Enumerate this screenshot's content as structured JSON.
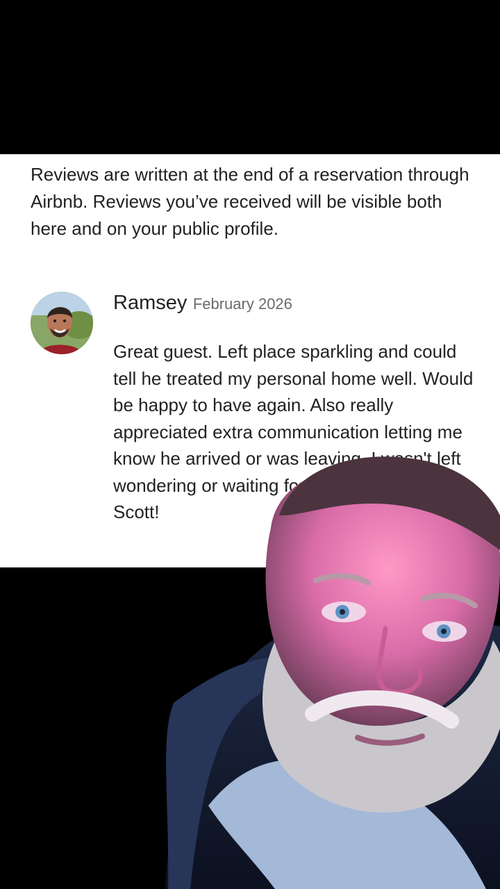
{
  "reviews_page": {
    "intro_text": "Reviews are written at the end of a reservation through Airbnb. Reviews you’ve received will be visible both here and on your public profile."
  },
  "review": {
    "reviewer_name": "Ramsey",
    "date": "February 2026",
    "body": "Great guest. Left place sparkling and could tell he treated my personal home well. Would be happy to have again. Also really appreciated extra communication letting me know he arrived or was leaving. I wasn't left wondering or waiting for anything. Thanks Scott!"
  },
  "colors": {
    "background": "#000000",
    "card": "#ffffff",
    "text_primary": "#222222",
    "text_secondary": "#6a6a6a"
  },
  "icons": {
    "reviewer_avatar": "avatar-photo",
    "presenter_overlay": "person-cutout"
  }
}
